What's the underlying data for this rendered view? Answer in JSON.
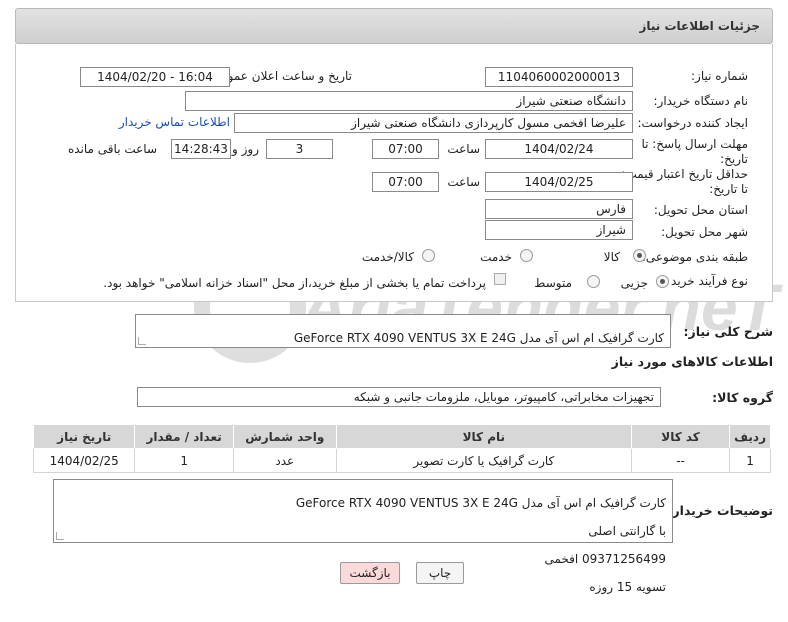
{
  "header": {
    "title": "جزئیات اطلاعات نیاز"
  },
  "fields": {
    "need_number_label": "شماره نیاز:",
    "need_number": "1104060002000013",
    "announce_label": "تاریخ و ساعت اعلان عمومی:",
    "announce_value": "1404/02/20 - 16:04",
    "buyer_org_label": "نام دستگاه خریدار:",
    "buyer_org": "دانشگاه صنعتی شیراز",
    "creator_label": "ایجاد کننده درخواست:",
    "creator": "علیرضا افخمی مسول کارپردازی دانشگاه صنعتی شیراز",
    "contact_link": "اطلاعات تماس خریدار",
    "reply_deadline_label": "مهلت ارسال پاسخ: تا تاریخ:",
    "reply_date": "1404/02/24",
    "time_label": "ساعت",
    "reply_time": "07:00",
    "days_value": "3",
    "days_label": "روز و",
    "remaining_time": "14:28:43",
    "remaining_label": "ساعت باقی مانده",
    "price_validity_label": "حداقل تاریخ اعتبار قیمت: تا تاریخ:",
    "price_date": "1404/02/25",
    "price_time": "07:00",
    "province_label": "استان محل تحویل:",
    "province": "فارس",
    "city_label": "شهر محل تحویل:",
    "city": "شیراز",
    "category_label": "طبقه بندی موضوعی:",
    "category_options": [
      "کالا",
      "خدمت",
      "کالا/خدمت"
    ],
    "process_label": "نوع فرآیند خرید :",
    "process_options": [
      "جزیی",
      "متوسط"
    ],
    "payment_note": "پرداخت تمام یا بخشی از مبلغ خرید،از محل \"اسناد خزانه اسلامی\" خواهد بود."
  },
  "summary": {
    "label": "شرح کلی نیاز:",
    "text": "کارت گرافیک ام اس آی مدل GeForce RTX 4090 VENTUS 3X E 24G"
  },
  "goods_section": {
    "title": "اطلاعات کالاهای مورد نیاز",
    "group_label": "گروه کالا:",
    "group_value": "تجهیزات مخابراتی، کامپیوتر، موبایل، ملزومات جانبی و شبکه"
  },
  "table": {
    "headers": [
      "ردیف",
      "کد کالا",
      "نام کالا",
      "واحد شمارش",
      "تعداد / مقدار",
      "تاریخ نیاز"
    ],
    "rows": [
      {
        "row": "1",
        "code": "--",
        "name": "کارت گرافیک یا کارت تصویر",
        "unit": "عدد",
        "qty": "1",
        "date": "1404/02/25"
      }
    ]
  },
  "buyer_notes": {
    "label": "توضیحات خریدار:",
    "lines": [
      "کارت گرافیک ام اس آی مدل GeForce RTX 4090 VENTUS 3X E 24G",
      "با گارانتی اصلی",
      "09371256499 افخمی",
      "تسویه 15 روزه"
    ]
  },
  "buttons": {
    "print": "چاپ",
    "back": "بازگشت"
  },
  "watermark": {
    "text": "AriaTender.neT"
  },
  "colors": {
    "link": "#1a4fb3",
    "back_button_bg": "#f9d9d9",
    "watermark": "#c9c9c9"
  }
}
